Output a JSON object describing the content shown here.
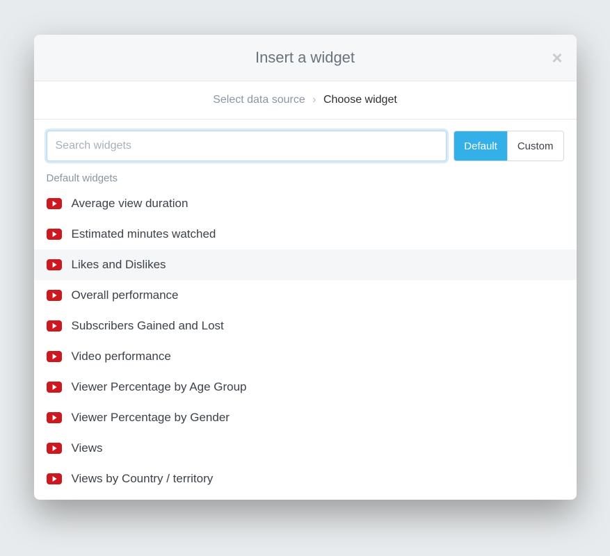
{
  "modal": {
    "title": "Insert a widget",
    "close_label": "×"
  },
  "breadcrumb": {
    "prev": "Select data source",
    "separator": "›",
    "current": "Choose widget"
  },
  "search": {
    "placeholder": "Search widgets",
    "value": ""
  },
  "filter": {
    "default_label": "Default",
    "custom_label": "Custom",
    "active": "default"
  },
  "section_label": "Default widgets",
  "widgets": [
    {
      "label": "Average view duration",
      "icon": "youtube",
      "hovered": false
    },
    {
      "label": "Estimated minutes watched",
      "icon": "youtube",
      "hovered": false
    },
    {
      "label": "Likes and Dislikes",
      "icon": "youtube",
      "hovered": true
    },
    {
      "label": "Overall performance",
      "icon": "youtube",
      "hovered": false
    },
    {
      "label": "Subscribers Gained and Lost",
      "icon": "youtube",
      "hovered": false
    },
    {
      "label": "Video performance",
      "icon": "youtube",
      "hovered": false
    },
    {
      "label": "Viewer Percentage by Age Group",
      "icon": "youtube",
      "hovered": false
    },
    {
      "label": "Viewer Percentage by Gender",
      "icon": "youtube",
      "hovered": false
    },
    {
      "label": "Views",
      "icon": "youtube",
      "hovered": false
    },
    {
      "label": "Views by Country / territory",
      "icon": "youtube",
      "hovered": false
    }
  ]
}
